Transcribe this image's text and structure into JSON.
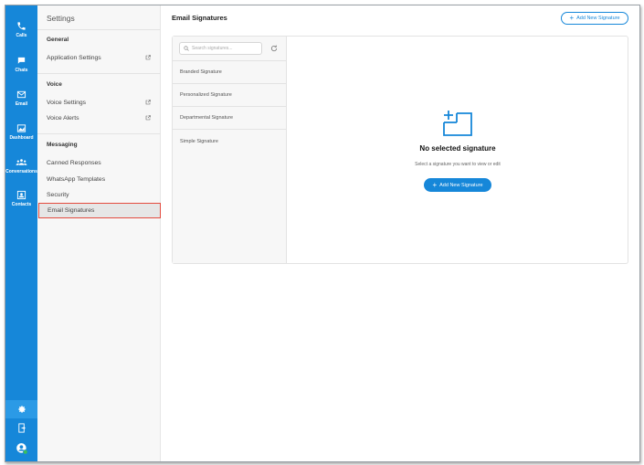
{
  "rail": {
    "items": [
      {
        "label": "Calls",
        "icon": "phone-icon"
      },
      {
        "label": "Chats",
        "icon": "chat-icon"
      },
      {
        "label": "Email",
        "icon": "mail-icon"
      },
      {
        "label": "Dashboard",
        "icon": "dashboard-icon"
      },
      {
        "label": "Conversations",
        "icon": "people-icon"
      },
      {
        "label": "Contacts",
        "icon": "contact-card-icon"
      }
    ],
    "bottom_icons": [
      "gear-icon",
      "logout-icon",
      "user-status-icon"
    ]
  },
  "menu": {
    "title": "Settings",
    "sections": [
      {
        "heading": "General",
        "items": [
          {
            "label": "Application Settings",
            "external": true
          }
        ]
      },
      {
        "heading": "Voice",
        "items": [
          {
            "label": "Voice Settings",
            "external": true
          },
          {
            "label": "Voice Alerts",
            "external": true
          }
        ]
      },
      {
        "heading": "Messaging",
        "items": [
          {
            "label": "Canned Responses"
          },
          {
            "label": "WhatsApp Templates"
          },
          {
            "label": "Security"
          },
          {
            "label": "Email Signatures",
            "selected": true
          }
        ]
      }
    ]
  },
  "main": {
    "title": "Email Signatures",
    "add_button": "Add New Signature",
    "search_placeholder": "Search signatures...",
    "signatures": [
      "Branded Signature",
      "Personalized Signature",
      "Departmental Signature",
      "Simple Signature"
    ],
    "empty_state": {
      "title": "No selected signature",
      "subtitle": "Select a signature you want to view or edit",
      "button": "Add New Signature"
    }
  },
  "colors": {
    "accent": "#1687d9",
    "highlight": "#e34b3f",
    "online": "#3bbf5a"
  }
}
